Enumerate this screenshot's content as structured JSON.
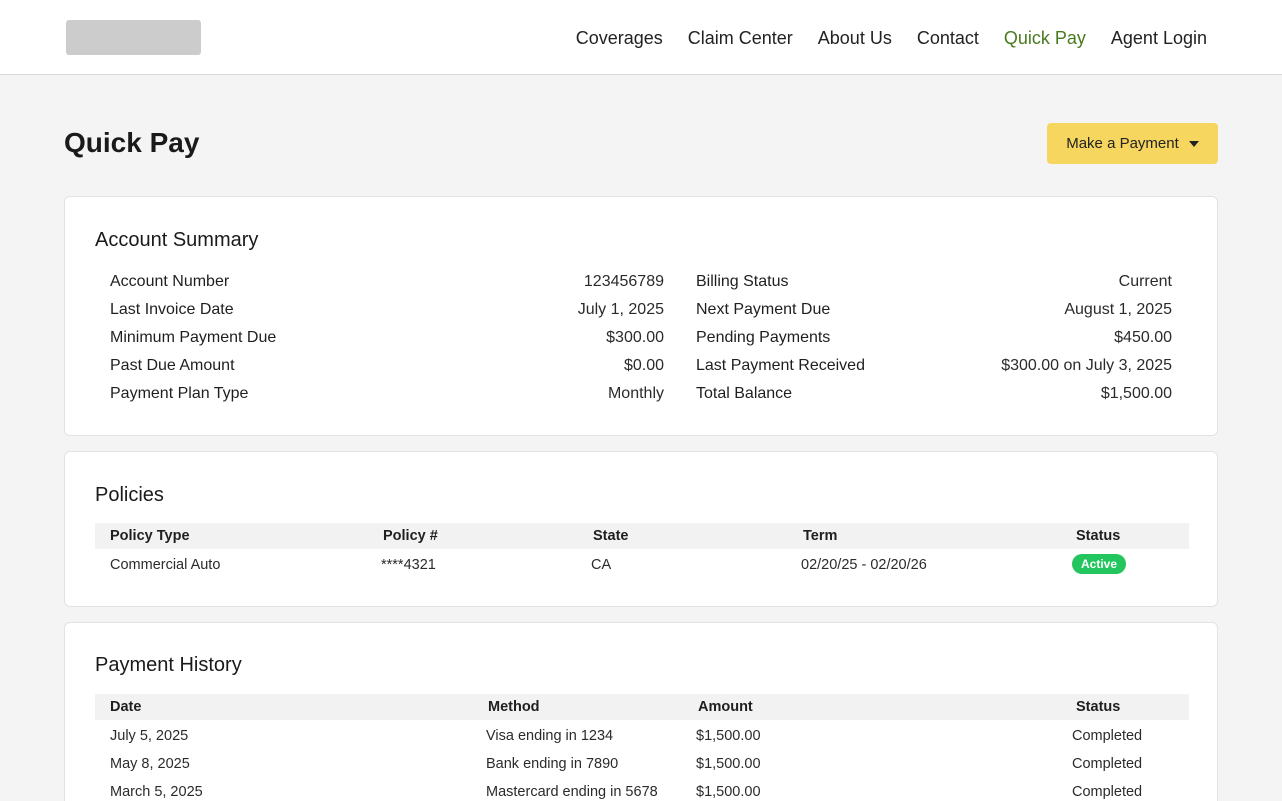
{
  "nav": {
    "items": [
      {
        "label": "Coverages",
        "active": false
      },
      {
        "label": "Claim Center",
        "active": false
      },
      {
        "label": "About Us",
        "active": false
      },
      {
        "label": "Contact",
        "active": false
      },
      {
        "label": "Quick Pay",
        "active": true
      },
      {
        "label": "Agent Login",
        "active": false
      }
    ],
    "active_color": "#4a7a1e"
  },
  "page": {
    "title": "Quick Pay",
    "make_payment_label": "Make a Payment",
    "button_color": "#f7d660"
  },
  "summary": {
    "title": "Account Summary",
    "left": [
      {
        "label": "Account Number",
        "value": "123456789"
      },
      {
        "label": "Last Invoice Date",
        "value": "July 1, 2025"
      },
      {
        "label": "Minimum Payment Due",
        "value": "$300.00"
      },
      {
        "label": "Past Due Amount",
        "value": "$0.00"
      },
      {
        "label": "Payment Plan Type",
        "value": "Monthly"
      }
    ],
    "right": [
      {
        "label": "Billing Status",
        "value": "Current"
      },
      {
        "label": "Next Payment Due",
        "value": "August 1, 2025"
      },
      {
        "label": "Pending Payments",
        "value": "$450.00"
      },
      {
        "label": "Last Payment Received",
        "value": "$300.00 on July 3, 2025"
      },
      {
        "label": "Total Balance",
        "value": "$1,500.00"
      }
    ]
  },
  "policies": {
    "title": "Policies",
    "headers": [
      "Policy Type",
      "Policy #",
      "State",
      "Term",
      "Status"
    ],
    "rows": [
      {
        "type": "Commercial Auto",
        "number": "****4321",
        "state": "CA",
        "term": "02/20/25 - 02/20/26",
        "status": "Active"
      }
    ],
    "status_color": "#22c55e"
  },
  "history": {
    "title": "Payment History",
    "headers": [
      "Date",
      "Method",
      "Amount",
      "Status"
    ],
    "rows": [
      {
        "date": "July 5, 2025",
        "method": "Visa ending in 1234",
        "amount": "$1,500.00",
        "status": "Completed"
      },
      {
        "date": "May 8, 2025",
        "method": "Bank ending in 7890",
        "amount": "$1,500.00",
        "status": "Completed"
      },
      {
        "date": "March 5, 2025",
        "method": "Mastercard ending in 5678",
        "amount": "$1,500.00",
        "status": "Completed"
      }
    ]
  }
}
